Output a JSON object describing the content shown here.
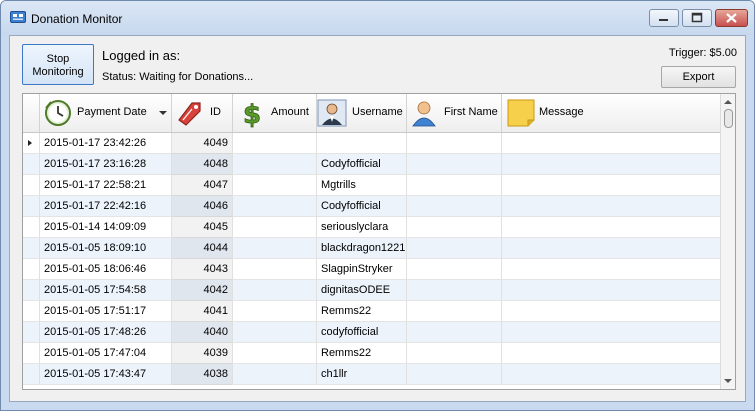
{
  "window": {
    "title": "Donation Monitor"
  },
  "toolbar": {
    "stop_label_line1": "Stop",
    "stop_label_line2": "Monitoring",
    "logged_in": "Logged in as:",
    "status": "Status: Waiting for Donations...",
    "trigger": "Trigger: $5.00",
    "export_label": "Export"
  },
  "grid": {
    "columns": {
      "date": "Payment Date",
      "id": "ID",
      "amount": "Amount",
      "username": "Username",
      "first_name": "First Name",
      "message": "Message"
    },
    "rows": [
      {
        "date": "2015-01-17 23:42:26",
        "id": "4049",
        "amount": "",
        "username": "",
        "first_name": "",
        "message": ""
      },
      {
        "date": "2015-01-17 23:16:28",
        "id": "4048",
        "amount": "",
        "username": "Codyfofficial",
        "first_name": "",
        "message": ""
      },
      {
        "date": "2015-01-17 22:58:21",
        "id": "4047",
        "amount": "",
        "username": "Mgtrills",
        "first_name": "",
        "message": ""
      },
      {
        "date": "2015-01-17 22:42:16",
        "id": "4046",
        "amount": "",
        "username": "Codyfofficial",
        "first_name": "",
        "message": ""
      },
      {
        "date": "2015-01-14 14:09:09",
        "id": "4045",
        "amount": "",
        "username": "seriouslyclara",
        "first_name": "",
        "message": ""
      },
      {
        "date": "2015-01-05 18:09:10",
        "id": "4044",
        "amount": "",
        "username": "blackdragon1221",
        "first_name": "",
        "message": ""
      },
      {
        "date": "2015-01-05 18:06:46",
        "id": "4043",
        "amount": "",
        "username": "SlagpinStryker",
        "first_name": "",
        "message": ""
      },
      {
        "date": "2015-01-05 17:54:58",
        "id": "4042",
        "amount": "",
        "username": "dignitasODEE",
        "first_name": "",
        "message": ""
      },
      {
        "date": "2015-01-05 17:51:17",
        "id": "4041",
        "amount": "",
        "username": "Remms22",
        "first_name": "",
        "message": ""
      },
      {
        "date": "2015-01-05 17:48:26",
        "id": "4040",
        "amount": "",
        "username": "codyfofficial",
        "first_name": "",
        "message": ""
      },
      {
        "date": "2015-01-05 17:47:04",
        "id": "4039",
        "amount": "",
        "username": "Remms22",
        "first_name": "",
        "message": ""
      },
      {
        "date": "2015-01-05 17:43:47",
        "id": "4038",
        "amount": "",
        "username": "ch1llr",
        "first_name": "",
        "message": ""
      }
    ],
    "selected_row": 0
  },
  "icons": {
    "app": "monitor-icon",
    "date": "clock-icon",
    "id": "tag-icon",
    "amount": "dollar-icon",
    "username": "user-suit-icon",
    "first_name": "user-icon",
    "message": "sticky-note-icon"
  },
  "colors": {
    "title_bg": "#c7d8ee",
    "alt_row": "#ecf3fb",
    "close_button": "#c75050",
    "dollar": "#5a9a2a",
    "tag": "#d9423a"
  }
}
